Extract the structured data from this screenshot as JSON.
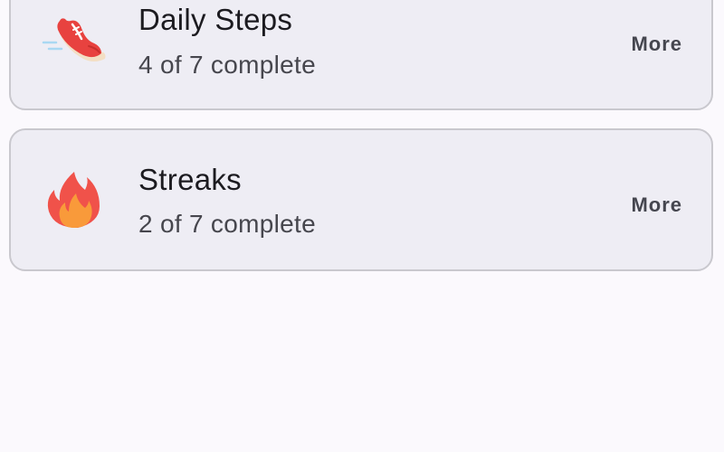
{
  "cards": [
    {
      "icon": "running-shoe-icon",
      "title": "Daily Steps",
      "subtitle": "4 of 7 complete",
      "action_label": "More"
    },
    {
      "icon": "flame-icon",
      "title": "Streaks",
      "subtitle": "2 of 7 complete",
      "action_label": "More"
    }
  ],
  "colors": {
    "background": "#fbf9fd",
    "card_background": "#eeedf4",
    "card_border": "#c9c8ce",
    "title_text": "#1c1b20",
    "subtitle_text": "#46464d",
    "shoe_red": "#e8423f",
    "flame_red": "#f0524a",
    "flame_orange": "#f99a3a"
  }
}
